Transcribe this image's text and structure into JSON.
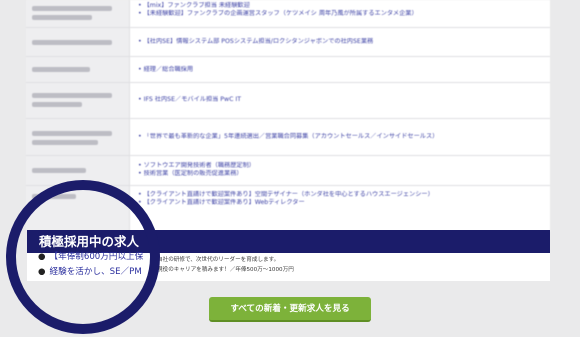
{
  "rows": [
    {
      "jobs": [
        "【mix】ファンクラブ担当 未経験歓迎",
        "【未経験歓迎】ファンクラブの企画運営スタッフ（ケツメイシ 周年乃風が所属するエンタメ企業）"
      ]
    },
    {
      "jobs": [
        "【社内SE】情報システム部 POSシステム担当/ロクシタンジャポンでの社内SE業務"
      ]
    },
    {
      "jobs": [
        "経理／総合職採用"
      ]
    },
    {
      "jobs": [
        "IFS 社内SE／モバイル担当 PwC IT"
      ]
    },
    {
      "jobs": [
        "「世界で最も革新的な企業」5年連続選出／営業職合同募集（アカウントセールス／インサイドセールス）"
      ]
    },
    {
      "jobs": [
        "ソフトウエア開発技術者（職務歴定制）",
        "技術営業（医定制の販売促進業務）"
      ]
    },
    {
      "jobs": [
        "【クライアント直請けで歓迎案件あり】空間デザイナー（ホンダ社を中心とするハウスエージェンシー）",
        "【クライアント直請けで歓迎案件あり】Webディレクター"
      ]
    }
  ],
  "feature": {
    "title": "積極採用中の求人",
    "items": [
      "【年俸制600万円以上保",
      "経験を活かし、SE／PM"
    ],
    "desc": [
      "自社の研修で、次世代のリーダーを育成します。",
      "現役のキャリアを積みます！／年俸500万〜1000万円"
    ]
  },
  "cta_label": "すべての新着・更新求人を見る",
  "colors": {
    "navy": "#1b1c6a",
    "green": "#7db23a",
    "link": "#3a3fa4"
  }
}
